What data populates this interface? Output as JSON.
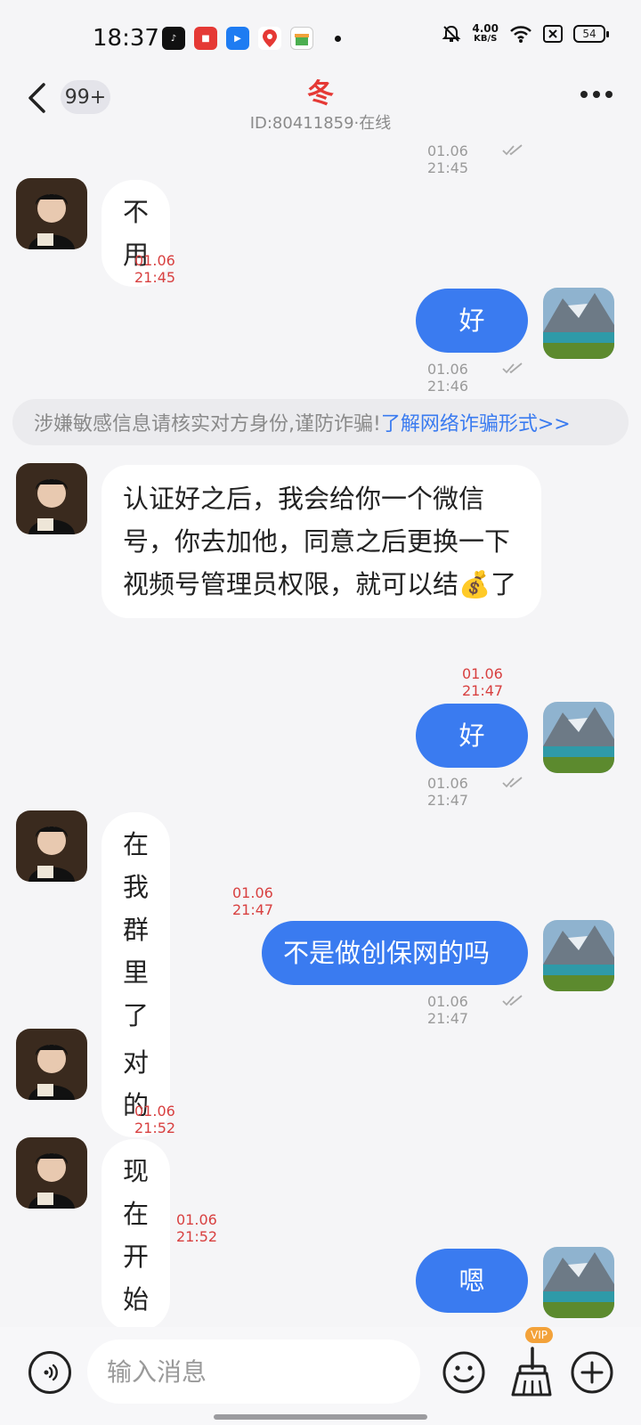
{
  "status_bar": {
    "time": "18:37",
    "net_speed_value": "4.00",
    "net_speed_unit": "KB/S",
    "battery": "54"
  },
  "header": {
    "unread_badge": "99+",
    "title": "冬",
    "subtitle": "ID:80411859·在线"
  },
  "messages": [
    {
      "side": "out",
      "time": "01.06 21:45"
    },
    {
      "side": "in",
      "text": "不用",
      "time": "01.06 21:45"
    },
    {
      "side": "out",
      "text": "好",
      "time": "01.06 21:46"
    },
    {
      "side": "in",
      "text": "认证好之后，我会给你一个微信号，你去加他，同意之后更换一下视频号管理员权限，就可以结💰了",
      "time": "01.06 21:47"
    },
    {
      "side": "out",
      "text": "好",
      "time": "01.06 21:47"
    },
    {
      "side": "in",
      "text": "在我群里了吧",
      "time": "01.06 21:47"
    },
    {
      "side": "out",
      "text": "不是做创保网的吗",
      "time": "01.06 21:47"
    },
    {
      "side": "in",
      "text": "对的",
      "time": "01.06 21:52"
    },
    {
      "side": "in",
      "text": "现在开始",
      "time": "01.06 21:52"
    },
    {
      "side": "out",
      "text": "嗯"
    }
  ],
  "warning": {
    "text": "涉嫌敏感信息请核实对方身份,谨防诈骗!",
    "link": "了解网络诈骗形式>>"
  },
  "input": {
    "placeholder": "输入消息"
  },
  "bottom": {
    "vip_label": "VIP"
  },
  "colors": {
    "accent": "#3a7bf0",
    "title": "#e53935",
    "in_time": "#d84040"
  }
}
